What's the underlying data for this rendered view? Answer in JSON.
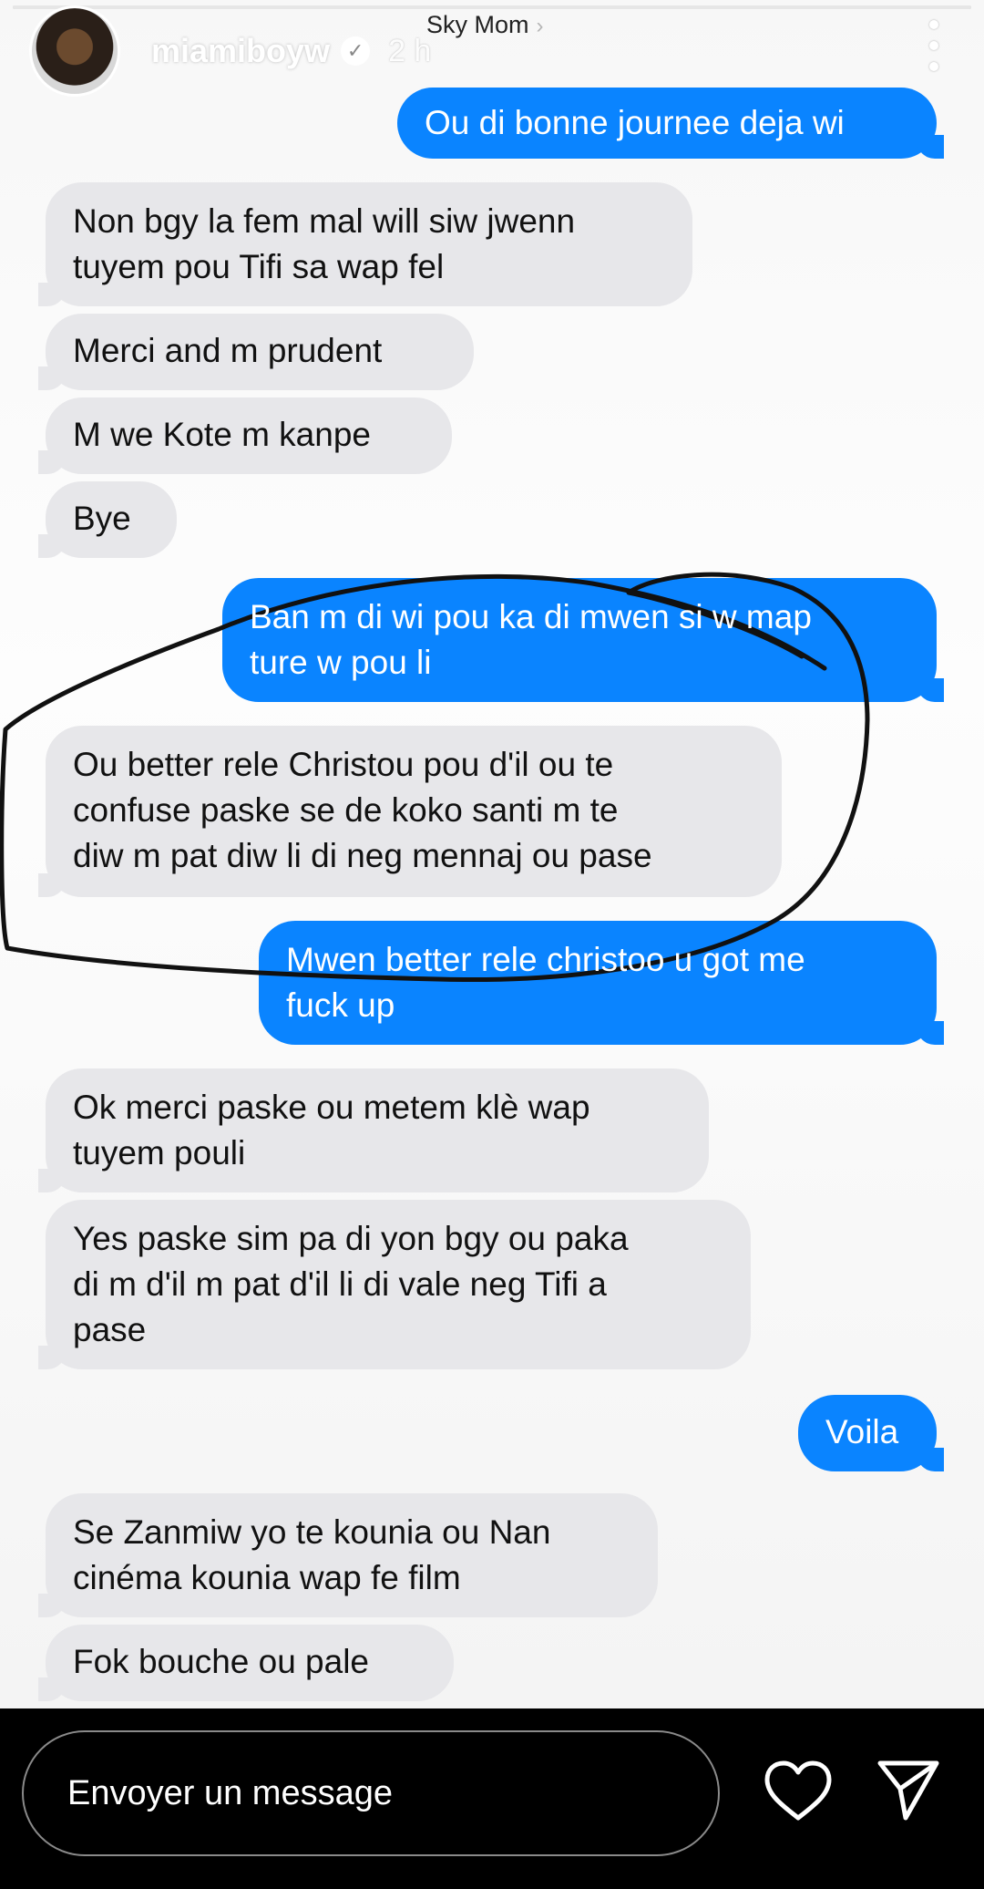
{
  "story": {
    "username": "miamiboyw",
    "verified_icon": "verified-check-icon",
    "time_posted": "2 h",
    "more_icon": "more-vertical-icon",
    "progress": 0.0
  },
  "conversation": {
    "contact_name": "Sky Mom",
    "messages": [
      {
        "from": "me",
        "text": "Ou di bonne journee deja wi"
      },
      {
        "from": "them",
        "text": "Non bgy la fem mal will siw jwenn\ntuyem pou Tifi sa wap fel"
      },
      {
        "from": "them",
        "text": "Merci and m prudent"
      },
      {
        "from": "them",
        "text": "M we Kote m kanpe"
      },
      {
        "from": "them",
        "text": "Bye"
      },
      {
        "from": "me",
        "text": "Ban m di wi pou ka di mwen si w map\nture w pou li"
      },
      {
        "from": "them",
        "text": "Ou better rele Christou pou d'il ou te\nconfuse paske se  de koko santi m te\ndiw m pat diw li di neg mennaj ou pase"
      },
      {
        "from": "me",
        "text": "Mwen better rele christoo u got me\nfuck up"
      },
      {
        "from": "them",
        "text": "Ok merci paske ou metem klè wap\ntuyem pouli"
      },
      {
        "from": "them",
        "text": "Yes paske sim pa di yon bgy ou paka\ndi m d'il m pat d'il li di vale neg Tifi a\npase"
      },
      {
        "from": "me",
        "text": "Voila"
      },
      {
        "from": "them",
        "text": "Se Zanmiw yo te kounia ou Nan\ncinéma kounia wap fe film"
      },
      {
        "from": "them",
        "text": "Fok bouche ou pale"
      }
    ]
  },
  "composer": {
    "placeholder": "Envoyer un message",
    "like_icon": "heart-icon",
    "share_icon": "send-icon"
  },
  "colors": {
    "sent_bubble": "#0a84ff",
    "received_bubble": "#e7e7ea",
    "annotation_stroke": "#111111"
  }
}
